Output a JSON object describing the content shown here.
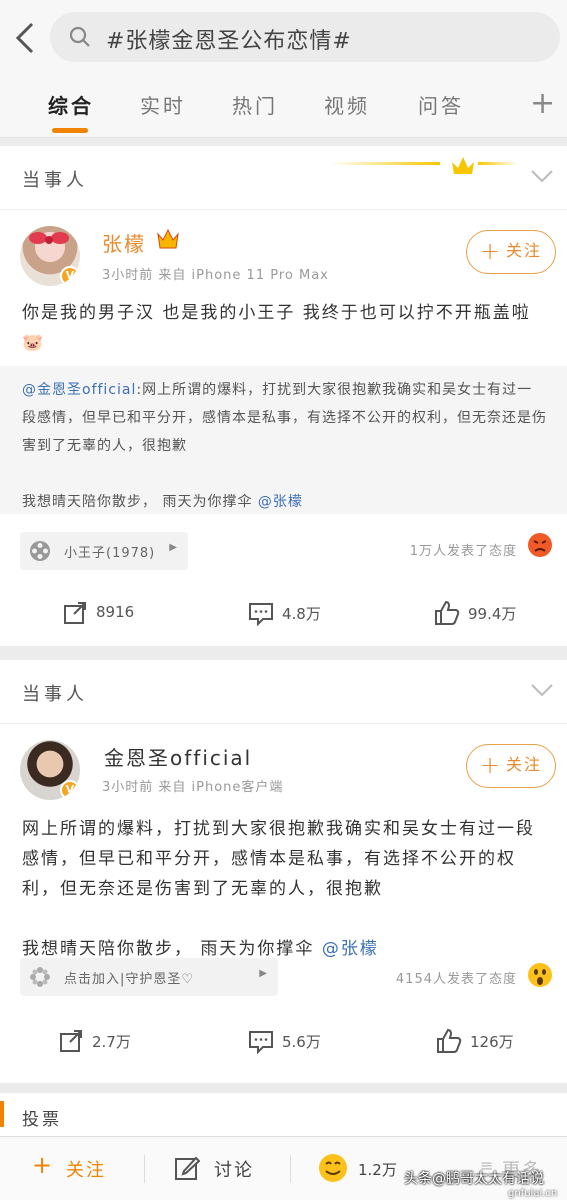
{
  "search": {
    "query": "#张檬金恩圣公布恋情#"
  },
  "tabs": [
    {
      "label": "综合"
    },
    {
      "label": "实时"
    },
    {
      "label": "热门"
    },
    {
      "label": "视频"
    },
    {
      "label": "问答"
    }
  ],
  "tab_add": "+",
  "colors": {
    "accent": "#f08300",
    "link": "#3b6fb6",
    "follow": "#e8892b"
  },
  "posts": [
    {
      "section": "当事人",
      "username": "张檬",
      "meta": "3小时前 来自 iPhone 11 Pro Max",
      "follow_label": "关注",
      "text": "你是我的男子汉 也是我的小王子 我终于也可以拧不开瓶盖啦🐷",
      "quote_mention": "@金恩圣official",
      "quote_text": ":网上所谓的爆料，打扰到大家很抱歉我确实和吴女士有过一段感情，但早已和平分开，感情本是私事，有选择不公开的权利，但无奈还是伤害到了无辜的人，很抱歉",
      "quote_text2": "我想晴天陪你散步， 雨天为你撑伞",
      "quote_mention2": "@张檬",
      "pill": "小王子(1978)",
      "reaction": "1万人发表了态度",
      "reaction_emoji": "angry-face-icon",
      "reposts": "8916",
      "comments": "4.8万",
      "likes": "99.4万"
    },
    {
      "section": "当事人",
      "username": "金恩圣official",
      "meta": "3小时前 来自 iPhone客户端",
      "follow_label": "关注",
      "text": "网上所谓的爆料，打扰到大家很抱歉我确实和吴女士有过一段感情，但早已和平分开，感情本是私事，有选择不公开的权利，但无奈还是伤害到了无辜的人，很抱歉",
      "text2": "我想晴天陪你散步， 雨天为你撑伞",
      "mention2": "@张檬",
      "pill": "点击加入|守护恩圣♡",
      "reaction": "4154人发表了态度",
      "reaction_emoji": "surprised-face-icon",
      "reposts": "2.7万",
      "comments": "5.6万",
      "likes": "126万"
    }
  ],
  "vote": {
    "title": "投票"
  },
  "bottom": {
    "follow": "关注",
    "discuss": "讨论",
    "count": "1.2万",
    "more": "更多"
  },
  "watermark": "头条@鹏哥太太有话说",
  "watermark2": "gnfulai.cn"
}
